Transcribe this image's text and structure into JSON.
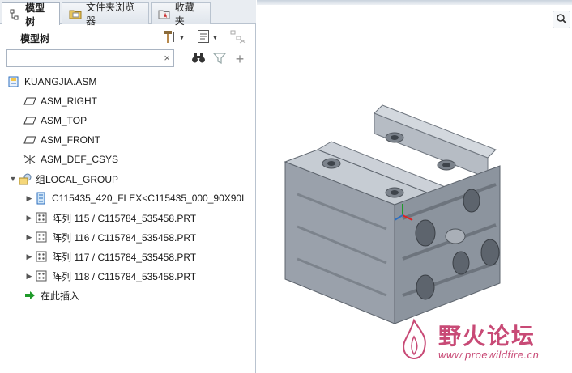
{
  "tabs": [
    {
      "label": "模型树",
      "icon": "model-tree-icon"
    },
    {
      "label": "文件夹浏览器",
      "icon": "folder-browser-icon"
    },
    {
      "label": "收藏夹",
      "icon": "favorites-icon"
    }
  ],
  "panel": {
    "title": "模型树",
    "search": {
      "value": "",
      "placeholder": "",
      "clear_glyph": "×"
    }
  },
  "tree": [
    {
      "label": "KUANGJIA.ASM",
      "icon": "assembly-icon",
      "level": 0,
      "expander": ""
    },
    {
      "label": "ASM_RIGHT",
      "icon": "datum-plane-icon",
      "level": 1,
      "expander": ""
    },
    {
      "label": "ASM_TOP",
      "icon": "datum-plane-icon",
      "level": 1,
      "expander": ""
    },
    {
      "label": "ASM_FRONT",
      "icon": "datum-plane-icon",
      "level": 1,
      "expander": ""
    },
    {
      "label": "ASM_DEF_CSYS",
      "icon": "csys-icon",
      "level": 1,
      "expander": ""
    },
    {
      "label": "组LOCAL_GROUP",
      "icon": "group-icon",
      "level": 1,
      "expander": "▼"
    },
    {
      "label": "C115435_420_FLEX<C115435_000_90X90L",
      "icon": "flex-part-icon",
      "level": 2,
      "expander": "▶"
    },
    {
      "label": "阵列 115 / C115784_535458.PRT",
      "icon": "pattern-icon",
      "level": 2,
      "expander": "▶"
    },
    {
      "label": "阵列 116 / C115784_535458.PRT",
      "icon": "pattern-icon",
      "level": 2,
      "expander": "▶"
    },
    {
      "label": "阵列 117 / C115784_535458.PRT",
      "icon": "pattern-icon",
      "level": 2,
      "expander": "▶"
    },
    {
      "label": "阵列 118 / C115784_535458.PRT",
      "icon": "pattern-icon",
      "level": 2,
      "expander": "▶"
    },
    {
      "label": "在此插入",
      "icon": "insert-here-arrow-icon",
      "level": 1,
      "expander": ""
    }
  ],
  "watermark": {
    "title": "野火论坛",
    "url": "www.proewildfire.cn"
  },
  "colors": {
    "accent": "#2e6fbf",
    "watermark": "#c84a76",
    "model": "#8c949e"
  }
}
